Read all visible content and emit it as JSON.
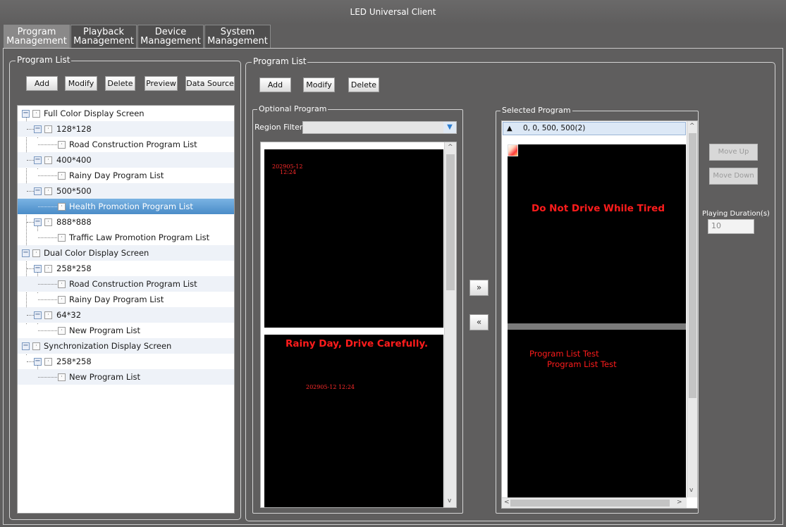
{
  "window": {
    "title": "LED Universal Client"
  },
  "tabs": [
    {
      "line1": "Program",
      "line2": "Management"
    },
    {
      "line1": "Playback",
      "line2": "Management"
    },
    {
      "line1": "Device",
      "line2": "Management"
    },
    {
      "line1": "System",
      "line2": "Management"
    }
  ],
  "left_panel": {
    "title": "Program List",
    "buttons": {
      "add": "Add",
      "modify": "Modify",
      "delete": "Delete",
      "preview": "Preview",
      "data_source": "Data Source"
    }
  },
  "tree": {
    "full_color": "Full Color Display Screen",
    "fc_128": "128*128",
    "fc_128_road": "Road Construction Program List",
    "fc_400": "400*400",
    "fc_400_rainy": "Rainy Day Program List",
    "fc_500": "500*500",
    "fc_500_health": "Health Promotion Program List",
    "fc_888": "888*888",
    "fc_888_traffic": "Traffic Law Promotion Program List",
    "dual_color": "Dual Color Display Screen",
    "dc_258": "258*258",
    "dc_258_road": "Road Construction Program List",
    "dc_258_rainy": "Rainy Day Program List",
    "dc_64": "64*32",
    "dc_64_new": "New Program List",
    "sync": "Synchronization Display Screen",
    "sync_258": "258*258",
    "sync_258_new": "New Program List"
  },
  "right_panel": {
    "title": "Program List",
    "buttons": {
      "add": "Add",
      "modify": "Modify",
      "delete": "Delete"
    }
  },
  "optional_program": {
    "title": "Optional Program",
    "region_filter_label": "Region Filter",
    "region_filter_value": "",
    "preview1_datetime_line1": "202905-12",
    "preview1_datetime_line2": "12:24",
    "preview2_text": "Rainy Day, Drive Carefully.",
    "preview2_datetime": "202905-12 12:24"
  },
  "transfer": {
    "add_label": "»",
    "remove_label": "«"
  },
  "selected_program": {
    "title": "Selected Program",
    "region_header": "0, 0, 500, 500(2)",
    "preview1_text": "Do Not Drive While Tired",
    "preview2_line1": "Program List Test",
    "preview2_line2": "Program List Test"
  },
  "side_controls": {
    "move_up": "Move Up",
    "move_down": "Move Down",
    "duration_label": "Playing Duration(s)",
    "duration_value": "10"
  },
  "colors": {
    "led_red": "#ff1c1c",
    "selection_blue": "#4a8cc8",
    "background": "#5f5e5e"
  }
}
